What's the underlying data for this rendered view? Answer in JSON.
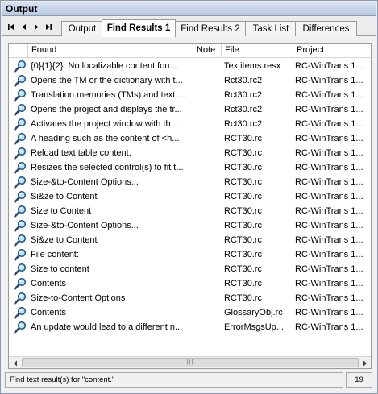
{
  "panel": {
    "title": "Output"
  },
  "tabs": [
    {
      "label": "Output",
      "active": false
    },
    {
      "label": "Find Results 1",
      "active": true
    },
    {
      "label": "Find Results 2",
      "active": false
    },
    {
      "label": "Task List",
      "active": false
    },
    {
      "label": "Differences",
      "active": false
    }
  ],
  "nav": [
    "first-icon",
    "previous-icon",
    "next-icon",
    "last-icon"
  ],
  "columns": {
    "found": "Found",
    "note": "Note",
    "file": "File",
    "project": "Project"
  },
  "rows": [
    {
      "icon": "magnifier-icon",
      "found": "{0}{1}{2}: No localizable content fou...",
      "note": "",
      "file": "Textitems.resx",
      "project": "RC-WinTrans 1..."
    },
    {
      "icon": "magnifier-icon",
      "found": "Opens the TM or the dictionary with t...",
      "note": "",
      "file": "Rct30.rc2",
      "project": "RC-WinTrans 1..."
    },
    {
      "icon": "magnifier-icon",
      "found": "Translation memories (TMs) and text ...",
      "note": "",
      "file": "Rct30.rc2",
      "project": "RC-WinTrans 1..."
    },
    {
      "icon": "magnifier-icon",
      "found": "Opens the project and displays the tr...",
      "note": "",
      "file": "Rct30.rc2",
      "project": "RC-WinTrans 1..."
    },
    {
      "icon": "magnifier-icon",
      "found": "Activates the project window with th...",
      "note": "",
      "file": "Rct30.rc2",
      "project": "RC-WinTrans 1..."
    },
    {
      "icon": "magnifier-icon",
      "found": "A heading such as the content of <h...",
      "note": "",
      "file": "RCT30.rc",
      "project": "RC-WinTrans 1..."
    },
    {
      "icon": "magnifier-icon",
      "found": "Reload text table content.",
      "note": "",
      "file": "RCT30.rc",
      "project": "RC-WinTrans 1..."
    },
    {
      "icon": "magnifier-icon",
      "found": "Resizes the selected control(s) to fit t...",
      "note": "",
      "file": "RCT30.rc",
      "project": "RC-WinTrans 1..."
    },
    {
      "icon": "magnifier-icon",
      "found": "Size-&to-Content Options...",
      "note": "",
      "file": "RCT30.rc",
      "project": "RC-WinTrans 1..."
    },
    {
      "icon": "magnifier-icon",
      "found": "Si&ze to Content",
      "note": "",
      "file": "RCT30.rc",
      "project": "RC-WinTrans 1..."
    },
    {
      "icon": "magnifier-icon",
      "found": "Size to Content",
      "note": "",
      "file": "RCT30.rc",
      "project": "RC-WinTrans 1..."
    },
    {
      "icon": "magnifier-icon",
      "found": "Size-&to-Content Options...",
      "note": "",
      "file": "RCT30.rc",
      "project": "RC-WinTrans 1..."
    },
    {
      "icon": "magnifier-icon",
      "found": "Si&ze to Content",
      "note": "",
      "file": "RCT30.rc",
      "project": "RC-WinTrans 1..."
    },
    {
      "icon": "magnifier-icon",
      "found": "File content:",
      "note": "",
      "file": "RCT30.rc",
      "project": "RC-WinTrans 1..."
    },
    {
      "icon": "magnifier-icon",
      "found": "Size to content",
      "note": "",
      "file": "RCT30.rc",
      "project": "RC-WinTrans 1..."
    },
    {
      "icon": "magnifier-icon",
      "found": "Contents",
      "note": "",
      "file": "RCT30.rc",
      "project": "RC-WinTrans 1..."
    },
    {
      "icon": "magnifier-icon",
      "found": "Size-to-Content Options",
      "note": "",
      "file": "RCT30.rc",
      "project": "RC-WinTrans 1..."
    },
    {
      "icon": "magnifier-icon",
      "found": "Contents",
      "note": "",
      "file": "GlossaryObj.rc",
      "project": "RC-WinTrans 1..."
    },
    {
      "icon": "magnifier-icon",
      "found": "An update would lead to a different n...",
      "note": "",
      "file": "ErrorMsgsUp...",
      "project": "RC-WinTrans 1..."
    }
  ],
  "status": {
    "text": "Find text result(s) for \"content.\"",
    "count": "19"
  }
}
